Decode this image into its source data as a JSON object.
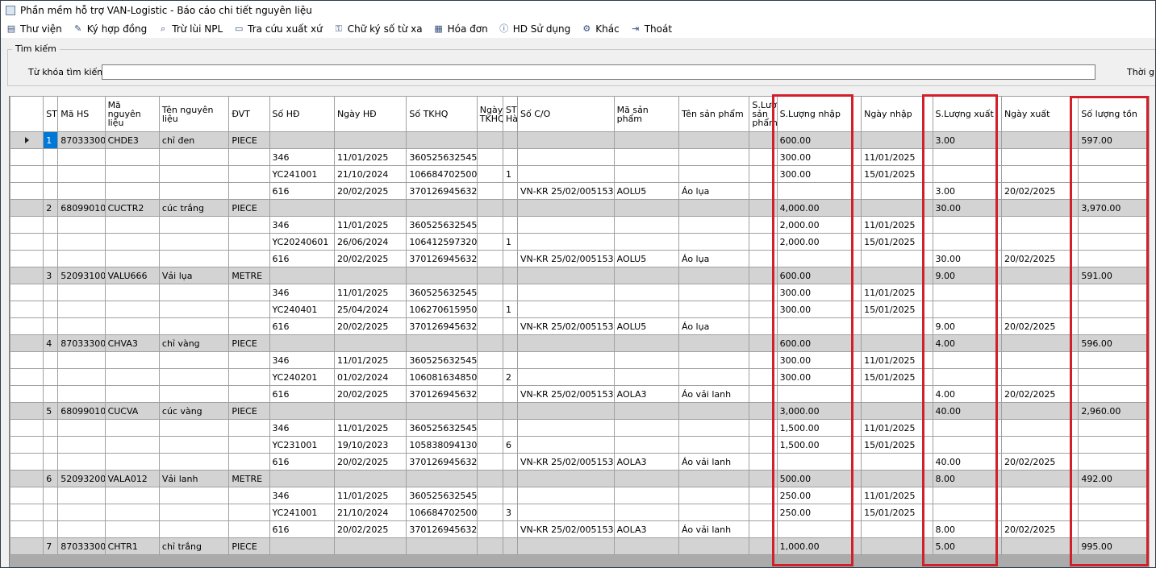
{
  "window": {
    "title": "Phần mềm hỗ trợ VAN-Logistic - Báo cáo chi tiết nguyên liệu"
  },
  "toolbar": [
    {
      "label": "Thư viện",
      "icon": "library-icon"
    },
    {
      "label": "Ký hợp đồng",
      "icon": "sign-contract-icon"
    },
    {
      "label": "Trừ lùi NPL",
      "icon": "search-icon"
    },
    {
      "label": "Tra cứu xuất xứ",
      "icon": "document-icon"
    },
    {
      "label": "Chữ ký số từ xa",
      "icon": "lock-icon"
    },
    {
      "label": "Hóa đơn",
      "icon": "invoice-icon"
    },
    {
      "label": "HD Sử dụng",
      "icon": "help-icon"
    },
    {
      "label": "Khác",
      "icon": "gear-icon"
    },
    {
      "label": "Thoát",
      "icon": "exit-icon"
    }
  ],
  "search": {
    "group_label": "Tìm kiếm",
    "keyword_label": "Từ khóa tìm kiếm:",
    "keyword_value": "",
    "time_label": "Thời gia"
  },
  "columns": [
    "ST",
    "Mã HS",
    "Mã nguyên liệu",
    "Tên nguyên liệu",
    "ĐVT",
    "Số HĐ",
    "Ngày HĐ",
    "Số TKHQ",
    "Ngày TKHQ",
    "ST Hà",
    "Số C/O",
    "Mã sản phẩm",
    "Tên sản phẩm",
    "S.Lượng sản phẩm",
    "S.Lượng nhập",
    "Ngày nhập",
    "S.Lượng xuất",
    "Ngày xuất",
    "Số lượng tồn"
  ],
  "rows": [
    {
      "type": "group",
      "selected": true,
      "cells": [
        "1",
        "87033300",
        "CHDE3",
        "chỉ đen",
        "PIECE",
        "",
        "",
        "",
        "",
        "",
        "",
        "",
        "",
        "",
        "600.00",
        "",
        "3.00",
        "",
        "597.00"
      ]
    },
    {
      "type": "detail",
      "cells": [
        "",
        "",
        "",
        "",
        "",
        "346",
        "11/01/2025",
        "360525632545",
        "",
        "",
        "",
        "",
        "",
        "",
        "300.00",
        "11/01/2025",
        "",
        "",
        ""
      ]
    },
    {
      "type": "detail",
      "cells": [
        "",
        "",
        "",
        "",
        "",
        "YC241001",
        "21/10/2024",
        "106684702500",
        "",
        "1",
        "",
        "",
        "",
        "",
        "300.00",
        "15/01/2025",
        "",
        "",
        ""
      ]
    },
    {
      "type": "detail",
      "cells": [
        "",
        "",
        "",
        "",
        "",
        "616",
        "20/02/2025",
        "370126945632",
        "",
        "",
        "VN-KR 25/02/005153",
        "AOLU5",
        "Áo lụa",
        "",
        "",
        "",
        "3.00",
        "20/02/2025",
        ""
      ]
    },
    {
      "type": "group",
      "cells": [
        "2",
        "68099010",
        "CUCTR2",
        "cúc trắng",
        "PIECE",
        "",
        "",
        "",
        "",
        "",
        "",
        "",
        "",
        "",
        "4,000.00",
        "",
        "30.00",
        "",
        "3,970.00"
      ]
    },
    {
      "type": "detail",
      "cells": [
        "",
        "",
        "",
        "",
        "",
        "346",
        "11/01/2025",
        "360525632545",
        "",
        "",
        "",
        "",
        "",
        "",
        "2,000.00",
        "11/01/2025",
        "",
        "",
        ""
      ]
    },
    {
      "type": "detail",
      "cells": [
        "",
        "",
        "",
        "",
        "",
        "YC20240601",
        "26/06/2024",
        "106412597320",
        "",
        "1",
        "",
        "",
        "",
        "",
        "2,000.00",
        "15/01/2025",
        "",
        "",
        ""
      ]
    },
    {
      "type": "detail",
      "cells": [
        "",
        "",
        "",
        "",
        "",
        "616",
        "20/02/2025",
        "370126945632",
        "",
        "",
        "VN-KR 25/02/005153",
        "AOLU5",
        "Áo lụa",
        "",
        "",
        "",
        "30.00",
        "20/02/2025",
        ""
      ]
    },
    {
      "type": "group",
      "cells": [
        "3",
        "52093100",
        "VALU666",
        "Vải lụa",
        "METRE",
        "",
        "",
        "",
        "",
        "",
        "",
        "",
        "",
        "",
        "600.00",
        "",
        "9.00",
        "",
        "591.00"
      ]
    },
    {
      "type": "detail",
      "cells": [
        "",
        "",
        "",
        "",
        "",
        "346",
        "11/01/2025",
        "360525632545",
        "",
        "",
        "",
        "",
        "",
        "",
        "300.00",
        "11/01/2025",
        "",
        "",
        ""
      ]
    },
    {
      "type": "detail",
      "cells": [
        "",
        "",
        "",
        "",
        "",
        "YC240401",
        "25/04/2024",
        "106270615950",
        "",
        "1",
        "",
        "",
        "",
        "",
        "300.00",
        "15/01/2025",
        "",
        "",
        ""
      ]
    },
    {
      "type": "detail",
      "cells": [
        "",
        "",
        "",
        "",
        "",
        "616",
        "20/02/2025",
        "370126945632",
        "",
        "",
        "VN-KR 25/02/005153",
        "AOLU5",
        "Áo lụa",
        "",
        "",
        "",
        "9.00",
        "20/02/2025",
        ""
      ]
    },
    {
      "type": "group",
      "cells": [
        "4",
        "87033300",
        "CHVA3",
        "chỉ vàng",
        "PIECE",
        "",
        "",
        "",
        "",
        "",
        "",
        "",
        "",
        "",
        "600.00",
        "",
        "4.00",
        "",
        "596.00"
      ]
    },
    {
      "type": "detail",
      "cells": [
        "",
        "",
        "",
        "",
        "",
        "346",
        "11/01/2025",
        "360525632545",
        "",
        "",
        "",
        "",
        "",
        "",
        "300.00",
        "11/01/2025",
        "",
        "",
        ""
      ]
    },
    {
      "type": "detail",
      "cells": [
        "",
        "",
        "",
        "",
        "",
        "YC240201",
        "01/02/2024",
        "106081634850",
        "",
        "2",
        "",
        "",
        "",
        "",
        "300.00",
        "15/01/2025",
        "",
        "",
        ""
      ]
    },
    {
      "type": "detail",
      "cells": [
        "",
        "",
        "",
        "",
        "",
        "616",
        "20/02/2025",
        "370126945632",
        "",
        "",
        "VN-KR 25/02/005153",
        "AOLA3",
        "Áo vải lanh",
        "",
        "",
        "",
        "4.00",
        "20/02/2025",
        ""
      ]
    },
    {
      "type": "group",
      "cells": [
        "5",
        "68099010",
        "CUCVA",
        "cúc vàng",
        "PIECE",
        "",
        "",
        "",
        "",
        "",
        "",
        "",
        "",
        "",
        "3,000.00",
        "",
        "40.00",
        "",
        "2,960.00"
      ]
    },
    {
      "type": "detail",
      "cells": [
        "",
        "",
        "",
        "",
        "",
        "346",
        "11/01/2025",
        "360525632545",
        "",
        "",
        "",
        "",
        "",
        "",
        "1,500.00",
        "11/01/2025",
        "",
        "",
        ""
      ]
    },
    {
      "type": "detail",
      "cells": [
        "",
        "",
        "",
        "",
        "",
        "YC231001",
        "19/10/2023",
        "105838094130",
        "",
        "6",
        "",
        "",
        "",
        "",
        "1,500.00",
        "15/01/2025",
        "",
        "",
        ""
      ]
    },
    {
      "type": "detail",
      "cells": [
        "",
        "",
        "",
        "",
        "",
        "616",
        "20/02/2025",
        "370126945632",
        "",
        "",
        "VN-KR 25/02/005153",
        "AOLA3",
        "Áo vải lanh",
        "",
        "",
        "",
        "40.00",
        "20/02/2025",
        ""
      ]
    },
    {
      "type": "group",
      "cells": [
        "6",
        "52093200",
        "VALA012",
        "Vải lanh",
        "METRE",
        "",
        "",
        "",
        "",
        "",
        "",
        "",
        "",
        "",
        "500.00",
        "",
        "8.00",
        "",
        "492.00"
      ]
    },
    {
      "type": "detail",
      "cells": [
        "",
        "",
        "",
        "",
        "",
        "346",
        "11/01/2025",
        "360525632545",
        "",
        "",
        "",
        "",
        "",
        "",
        "250.00",
        "11/01/2025",
        "",
        "",
        ""
      ]
    },
    {
      "type": "detail",
      "cells": [
        "",
        "",
        "",
        "",
        "",
        "YC241001",
        "21/10/2024",
        "106684702500",
        "",
        "3",
        "",
        "",
        "",
        "",
        "250.00",
        "15/01/2025",
        "",
        "",
        ""
      ]
    },
    {
      "type": "detail",
      "cells": [
        "",
        "",
        "",
        "",
        "",
        "616",
        "20/02/2025",
        "370126945632",
        "",
        "",
        "VN-KR 25/02/005153",
        "AOLA3",
        "Áo vải lanh",
        "",
        "",
        "",
        "8.00",
        "20/02/2025",
        ""
      ]
    },
    {
      "type": "group",
      "cells": [
        "7",
        "87033300",
        "CHTR1",
        "chỉ trắng",
        "PIECE",
        "",
        "",
        "",
        "",
        "",
        "",
        "",
        "",
        "",
        "1,000.00",
        "",
        "5.00",
        "",
        "995.00"
      ]
    }
  ],
  "highlight_color": "#d0202c",
  "selection_color": "#0078d7"
}
